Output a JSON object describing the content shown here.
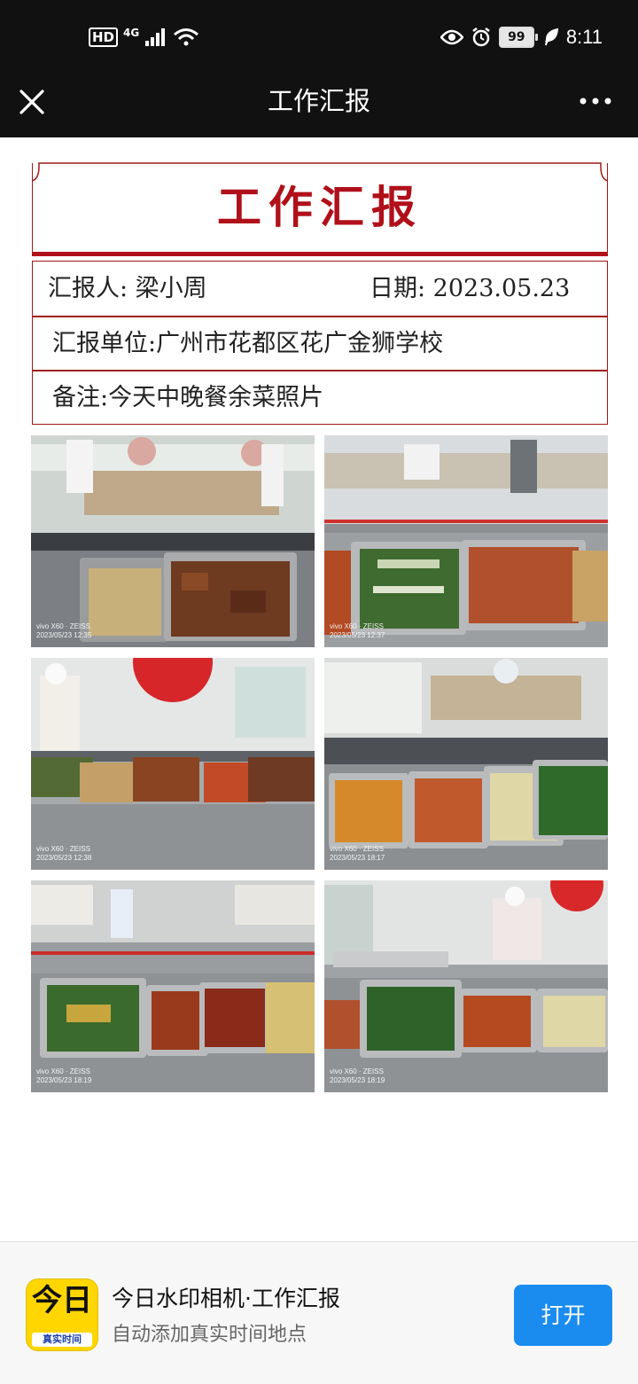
{
  "status_bar": {
    "hd": "HD",
    "network": "4G",
    "battery": "99",
    "time": "8:11",
    "icons": [
      "signal-icon",
      "wifi-icon",
      "eye-icon",
      "alarm-icon",
      "leaf-icon"
    ]
  },
  "nav": {
    "title": "工作汇报",
    "close_icon": "close-icon",
    "more_icon": "more-icon"
  },
  "report": {
    "title": "工作汇报",
    "reporter": "汇报人: 梁小周",
    "date": "日期: 2023.05.23",
    "unit": "汇报单位:广州市花都区花广金狮学校",
    "note": "备注:今天中晚餐余菜照片"
  },
  "photos": [
    {
      "watermark_brand": "vivo X60 · ZEISS",
      "watermark_time": "2023/05/23 12:35"
    },
    {
      "watermark_brand": "vivo X60 · ZEISS",
      "watermark_time": "2023/05/23 12:37"
    },
    {
      "watermark_brand": "vivo X60 · ZEISS",
      "watermark_time": "2023/05/23 12:38"
    },
    {
      "watermark_brand": "vivo X60 · ZEISS",
      "watermark_time": "2023/05/23 18:17"
    },
    {
      "watermark_brand": "vivo X60 · ZEISS",
      "watermark_time": "2023/05/23 18:19"
    },
    {
      "watermark_brand": "vivo X60 · ZEISS",
      "watermark_time": "2023/05/23 18:19"
    }
  ],
  "banner": {
    "icon_big": "今日",
    "icon_small": "真实时间",
    "app_name": "今日水印相机·工作汇报",
    "app_sub": "自动添加真实时间地点",
    "open_label": "打开"
  },
  "colors": {
    "accent_red": "#b0101a",
    "button_blue": "#1a8cf0",
    "app_yellow": "#ffd600",
    "bar_black": "#111111"
  }
}
